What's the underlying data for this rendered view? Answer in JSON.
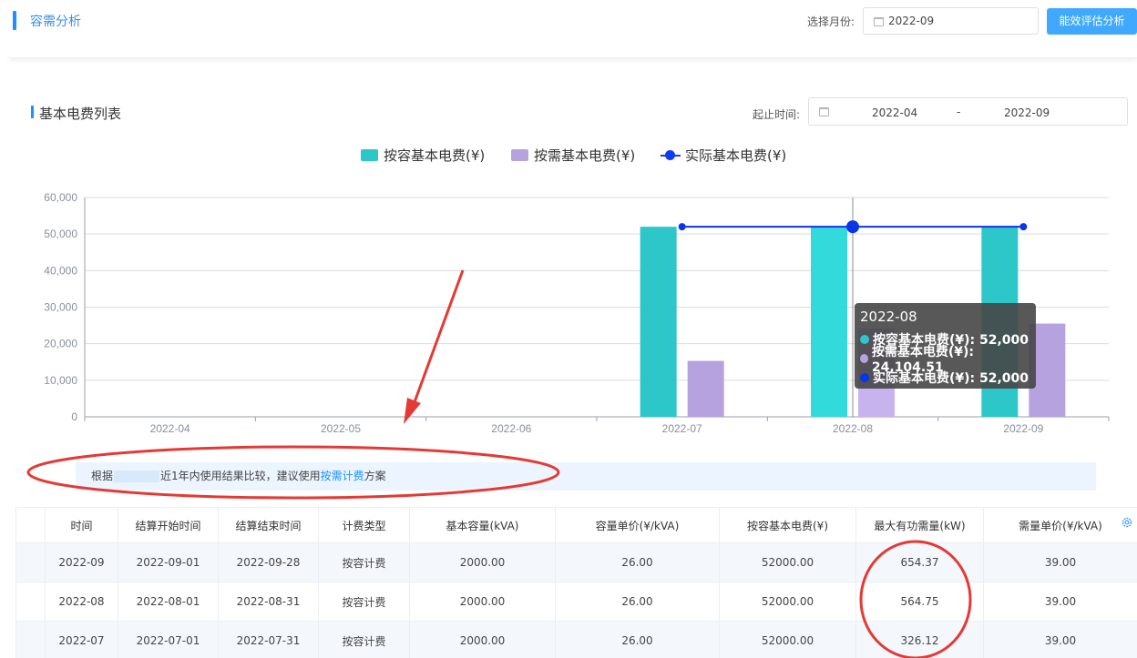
{
  "header": {
    "title": "容需分析",
    "month_label": "选择月份:",
    "month_value": "2022-09",
    "eval_button": "能效评估分析"
  },
  "section": {
    "title": "基本电费列表",
    "range_label": "起止时间:",
    "range_start": "2022-04",
    "range_sep": "-",
    "range_end": "2022-09"
  },
  "chart_data": {
    "type": "bar",
    "categories": [
      "2022-04",
      "2022-05",
      "2022-06",
      "2022-07",
      "2022-08",
      "2022-09"
    ],
    "series": [
      {
        "name": "按容基本电费(¥)",
        "type": "bar",
        "color": "#2ec7c9",
        "values": [
          0,
          0,
          0,
          52000,
          52000,
          52000
        ]
      },
      {
        "name": "按需基本电费(¥)",
        "type": "bar",
        "color": "#b6a2de",
        "values": [
          0,
          0,
          0,
          15300,
          24104.51,
          25500
        ]
      },
      {
        "name": "实际基本电费(¥)",
        "type": "line",
        "color": "#0a36e6",
        "values": [
          null,
          null,
          null,
          52000,
          52000,
          52000
        ]
      }
    ],
    "yticks": [
      "0",
      "10,000",
      "20,000",
      "30,000",
      "40,000",
      "50,000",
      "60,000"
    ],
    "ylim": [
      0,
      60000
    ],
    "grid": true,
    "legend": "top-center",
    "highlight_category": "2022-08"
  },
  "tooltip": {
    "title": "2022-08",
    "rows": [
      {
        "text": "按容基本电费(¥): 52,000",
        "color": "#2ec7c9"
      },
      {
        "text": "按需基本电费(¥): 24,104.51",
        "color": "#b6a2de"
      },
      {
        "text": "实际基本电费(¥): 52,000",
        "color": "#0a36e6"
      }
    ]
  },
  "notice": {
    "prefix": "根据",
    "middle": "近1年内使用结果比较，建议使用",
    "highlight": "按需计费",
    "suffix": "方案"
  },
  "table": {
    "headers": [
      "",
      "时间",
      "结算开始时间",
      "结算结束时间",
      "计费类型",
      "基本容量(kVA)",
      "容量单价(¥/kVA)",
      "按容基本电费(¥)",
      "最大有功需量(kW)",
      "需量单价(¥/kVA)"
    ],
    "rows": [
      [
        "",
        "2022-09",
        "2022-09-01",
        "2022-09-28",
        "按容计费",
        "2000.00",
        "26.00",
        "52000.00",
        "654.37",
        "39.00"
      ],
      [
        "",
        "2022-08",
        "2022-08-01",
        "2022-08-31",
        "按容计费",
        "2000.00",
        "26.00",
        "52000.00",
        "564.75",
        "39.00"
      ],
      [
        "",
        "2022-07",
        "2022-07-01",
        "2022-07-31",
        "按容计费",
        "2000.00",
        "26.00",
        "52000.00",
        "326.12",
        "39.00"
      ]
    ]
  },
  "colors": {
    "accent": "#1e90ff",
    "annotation": "#e53935"
  }
}
